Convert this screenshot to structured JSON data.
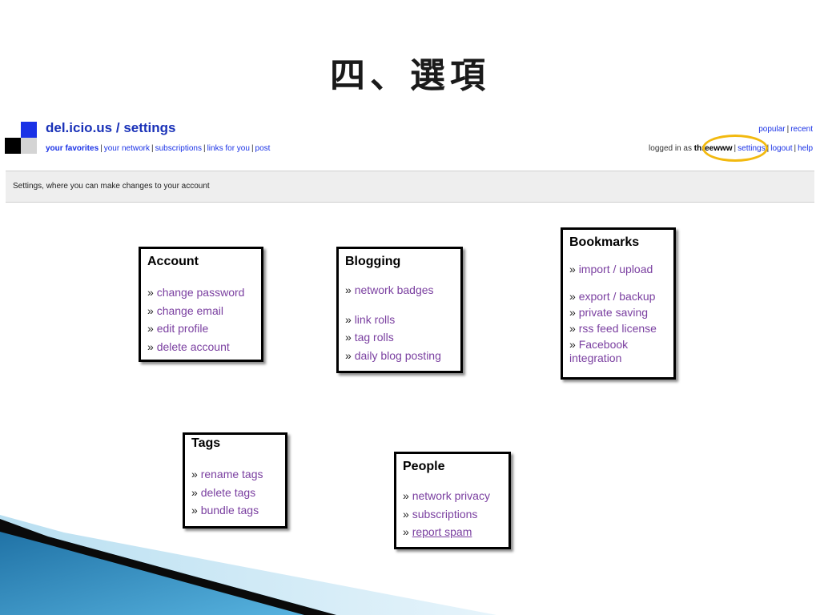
{
  "slide": {
    "title": "四、選項"
  },
  "header": {
    "site": "del.icio.us",
    "separator": " / ",
    "page": "settings",
    "nav_left": [
      "your favorites",
      "your network",
      "subscriptions",
      "links for you",
      "post"
    ],
    "top_right": [
      "popular",
      "recent"
    ],
    "logged_in_prefix": "logged in as ",
    "username": "threewww",
    "nav_right": [
      "settings",
      "logout",
      "help"
    ]
  },
  "subheader": {
    "text": "Settings, where you can make changes to your account"
  },
  "boxes": {
    "account": {
      "title": "Account",
      "items": [
        "change password",
        "change email",
        "edit profile",
        "delete account"
      ]
    },
    "blogging": {
      "title": "Blogging",
      "items": [
        "network badges",
        "link rolls",
        "tag rolls",
        "daily blog posting"
      ]
    },
    "bookmarks": {
      "title": "Bookmarks",
      "items": [
        "import / upload",
        "export / backup",
        "private saving",
        "rss feed license",
        "Facebook integration"
      ]
    },
    "tags": {
      "title": "Tags",
      "items": [
        "rename tags",
        "delete tags",
        "bundle tags"
      ]
    },
    "people": {
      "title": "People",
      "items": [
        "network privacy",
        "subscriptions",
        "report spam"
      ]
    }
  },
  "glyphs": {
    "raquo": "» ",
    "pipe": "|"
  },
  "colors": {
    "link_blue": "#1a32e6",
    "link_purple": "#7a3fa0",
    "highlight": "#f2b90f",
    "deco_blue": "#3f9dd1"
  }
}
